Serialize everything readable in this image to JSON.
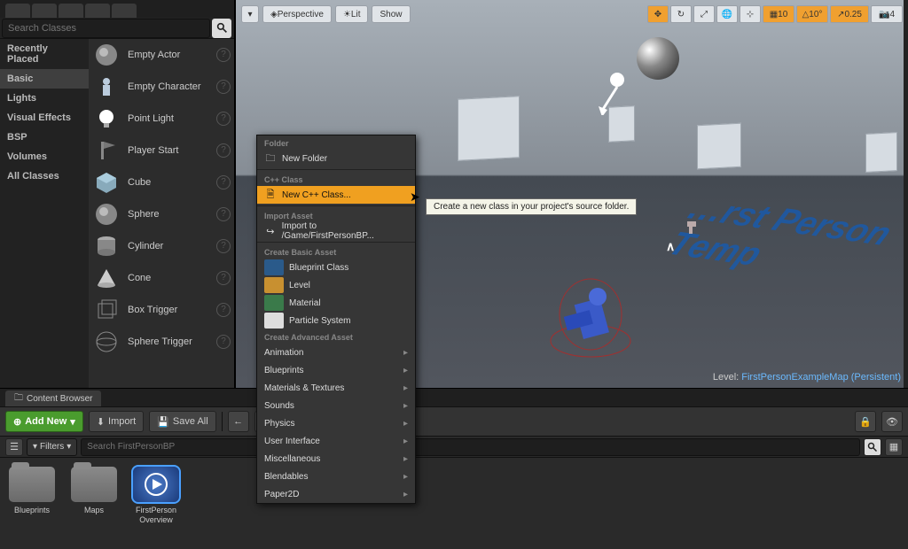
{
  "place_panel": {
    "search_placeholder": "Search Classes",
    "categories": [
      "Recently Placed",
      "Basic",
      "Lights",
      "Visual Effects",
      "BSP",
      "Volumes",
      "All Classes"
    ],
    "active_category": "Basic",
    "assets": [
      {
        "label": "Empty Actor",
        "icon": "sphere",
        "color": "#888"
      },
      {
        "label": "Empty Character",
        "icon": "character",
        "color": "#aab"
      },
      {
        "label": "Point Light",
        "icon": "bulb",
        "color": "#fff"
      },
      {
        "label": "Player Start",
        "icon": "flag",
        "color": "#777"
      },
      {
        "label": "Cube",
        "icon": "cube",
        "color": "#8ab"
      },
      {
        "label": "Sphere",
        "icon": "sphere",
        "color": "#888"
      },
      {
        "label": "Cylinder",
        "icon": "cylinder",
        "color": "#888"
      },
      {
        "label": "Cone",
        "icon": "cone",
        "color": "#ccc"
      },
      {
        "label": "Box Trigger",
        "icon": "wirebox",
        "color": "#666"
      },
      {
        "label": "Sphere Trigger",
        "icon": "wiresphere",
        "color": "#666"
      }
    ]
  },
  "viewport": {
    "dropdown_label": "",
    "perspective_label": "Perspective",
    "lit_label": "Lit",
    "show_label": "Show",
    "snap_grid": "10",
    "snap_angle": "10°",
    "snap_scale": "0.25",
    "cam_speed": "4",
    "floor_text": "…rst Person Temp",
    "level_label": "Level:",
    "level_name": "FirstPersonExampleMap (Persistent)"
  },
  "content_browser": {
    "tab_label": "Content Browser",
    "add_new_label": "Add New",
    "import_label": "Import",
    "save_all_label": "Save All",
    "filters_label": "Filters",
    "search_placeholder": "Search FirstPersonBP",
    "assets": [
      {
        "label": "Blueprints",
        "type": "folder"
      },
      {
        "label": "Maps",
        "type": "folder"
      },
      {
        "label": "FirstPerson\nOverview",
        "type": "overview"
      }
    ]
  },
  "context_menu": {
    "sections": [
      {
        "header": "Folder",
        "items": [
          {
            "label": "New Folder",
            "icon": "folder"
          }
        ]
      },
      {
        "header": "C++ Class",
        "items": [
          {
            "label": "New C++ Class...",
            "icon": "cpp",
            "highlight": true
          }
        ]
      },
      {
        "header": "Import Asset",
        "items": [
          {
            "label": "Import to /Game/FirstPersonBP...",
            "icon": "import"
          }
        ]
      },
      {
        "header": "Create Basic Asset",
        "items": [
          {
            "label": "Blueprint Class",
            "thumb": "#2a5a8a"
          },
          {
            "label": "Level",
            "thumb": "#c89030"
          },
          {
            "label": "Material",
            "thumb": "#3a7a4a"
          },
          {
            "label": "Particle System",
            "thumb": "#ddd"
          }
        ]
      },
      {
        "header": "Create Advanced Asset",
        "items": [
          {
            "label": "Animation",
            "sub": true
          },
          {
            "label": "Blueprints",
            "sub": true
          },
          {
            "label": "Materials & Textures",
            "sub": true
          },
          {
            "label": "Sounds",
            "sub": true
          },
          {
            "label": "Physics",
            "sub": true
          },
          {
            "label": "User Interface",
            "sub": true
          },
          {
            "label": "Miscellaneous",
            "sub": true
          },
          {
            "label": "Blendables",
            "sub": true
          },
          {
            "label": "Paper2D",
            "sub": true
          }
        ]
      }
    ]
  },
  "tooltip": "Create a new class in your project's source folder."
}
